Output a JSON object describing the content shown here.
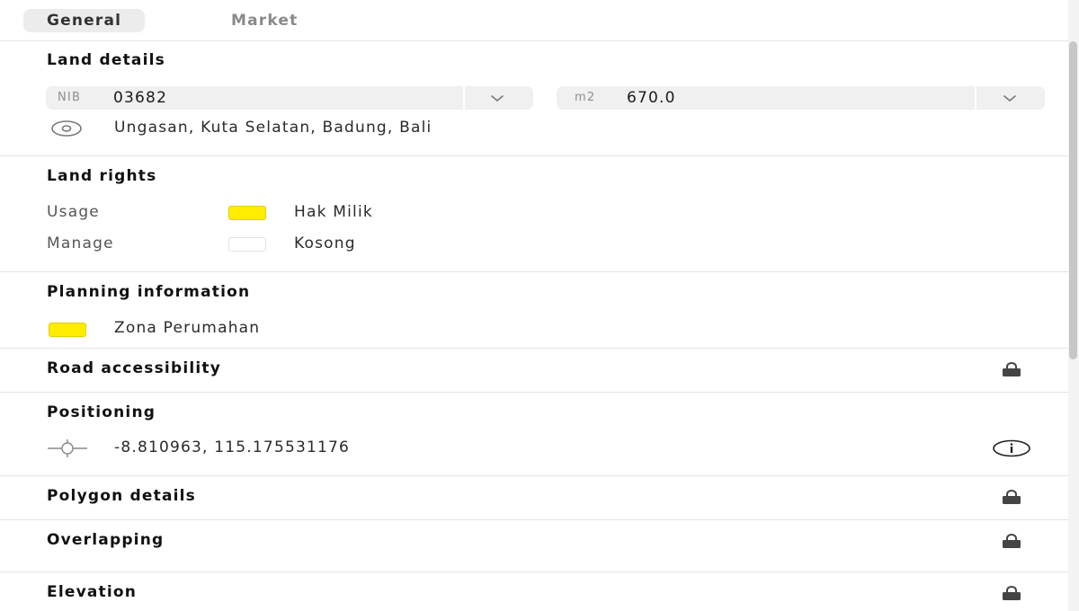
{
  "tabs": [
    {
      "label": "General",
      "active": true
    },
    {
      "label": "Market",
      "active": false
    }
  ],
  "land_details": {
    "title": "Land details",
    "nib": {
      "unit": "NIB",
      "value": "03682"
    },
    "area": {
      "unit": "m2",
      "value": "670.0"
    },
    "location": "Ungasan, Kuta Selatan, Badung, Bali"
  },
  "land_rights": {
    "title": "Land rights",
    "rows": [
      {
        "label": "Usage",
        "value": "Hak Milik",
        "color": "#ffec00"
      },
      {
        "label": "Manage",
        "value": "Kosong",
        "color": "#ffffff"
      }
    ]
  },
  "planning": {
    "title": "Planning information",
    "zone": "Zona Perumahan",
    "color": "#ffec00"
  },
  "road_accessibility": {
    "title": "Road accessibility",
    "locked": true
  },
  "positioning": {
    "title": "Positioning",
    "coordinates": "-8.810963, 115.175531176"
  },
  "polygon_details": {
    "title": "Polygon details",
    "locked": true
  },
  "overlapping": {
    "title": "Overlapping",
    "locked": true
  },
  "elevation": {
    "title": "Elevation",
    "locked": true
  }
}
